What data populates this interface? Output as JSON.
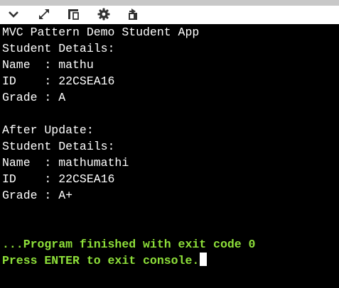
{
  "toolbar": {
    "icons": [
      {
        "name": "chevron-down-icon"
      },
      {
        "name": "expand-icon"
      },
      {
        "name": "split-view-icon"
      },
      {
        "name": "gear-icon"
      },
      {
        "name": "share-icon"
      }
    ]
  },
  "console": {
    "lines": [
      "MVC Pattern Demo Student App",
      "Student Details:",
      "Name  : mathu",
      "ID    : 22CSEA16",
      "Grade : A",
      "",
      "After Update:",
      "Student Details:",
      "Name  : mathumathi",
      "ID    : 22CSEA16",
      "Grade : A+",
      "",
      "",
      "...Program finished with exit code 0",
      "Press ENTER to exit console."
    ],
    "status_color": "#8ee03a"
  }
}
